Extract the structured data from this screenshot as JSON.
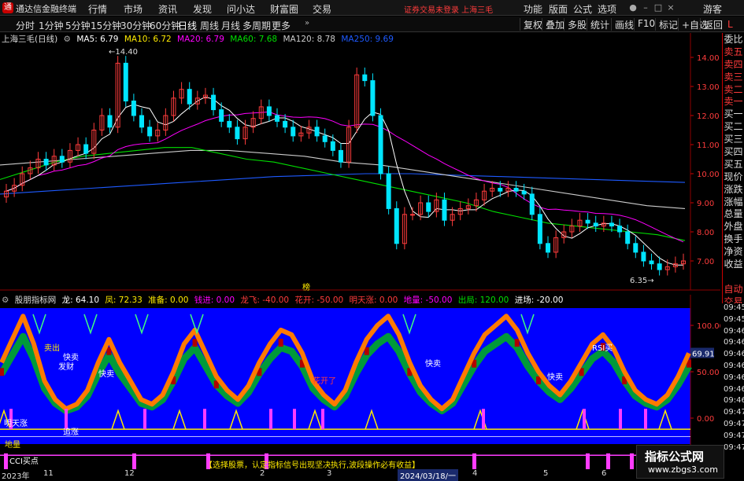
{
  "titlebar": {
    "app_name": "通达信金融终端",
    "menus": [
      "行情",
      "市场",
      "资讯",
      "发现",
      "问小达",
      "财富圈",
      "交易"
    ],
    "notice": "证券交易未登录  上海三毛",
    "right_menus": [
      "功能",
      "版面",
      "公式",
      "选项"
    ],
    "guest": "游客"
  },
  "tabbar": {
    "periods": [
      "分时",
      "1分钟",
      "5分钟",
      "15分钟",
      "30分钟",
      "60分钟",
      "日线",
      "周线",
      "月线",
      "多周期",
      "更多"
    ],
    "active": "日线",
    "tools": [
      "复权",
      "叠加",
      "多股",
      "统计",
      "画线",
      "F10",
      "标记",
      "+自选",
      "返回"
    ],
    "mark": "L"
  },
  "main_chart": {
    "stock_title": "上海三毛(日线)",
    "ma": [
      {
        "label": "MA5: 6.79",
        "color": "#ffffff"
      },
      {
        "label": "MA10: 6.72",
        "color": "#ffeb00"
      },
      {
        "label": "MA20: 6.79",
        "color": "#ff00ff"
      },
      {
        "label": "MA60: 7.68",
        "color": "#00e000"
      },
      {
        "label": "MA120: 8.78",
        "color": "#cccccc"
      },
      {
        "label": "MA250: 9.69",
        "color": "#1e5aff"
      }
    ],
    "y_ticks": [
      "14.00",
      "13.00",
      "12.00",
      "11.00",
      "10.00",
      "9.00",
      "8.00",
      "7.00"
    ],
    "high_label": "14.40",
    "low_label": "6.35",
    "marker": "榜",
    "candles_close": [
      9.4,
      9.6,
      10.0,
      10.2,
      10.5,
      10.3,
      10.6,
      10.4,
      10.8,
      11.0,
      10.7,
      11.5,
      12.0,
      11.6,
      13.8,
      12.5,
      12.0,
      11.6,
      11.3,
      11.5,
      12.0,
      12.6,
      12.9,
      12.4,
      12.6,
      12.7,
      12.2,
      11.8,
      11.6,
      11.2,
      11.6,
      11.9,
      12.3,
      12.0,
      11.8,
      11.6,
      11.3,
      11.4,
      11.6,
      11.3,
      11.1,
      10.8,
      10.4,
      11.6,
      13.4,
      13.2,
      12.0,
      10.0,
      8.8,
      7.6,
      8.6,
      8.6,
      9.0,
      8.7,
      9.1,
      8.4,
      8.6,
      8.8,
      8.9,
      9.1,
      9.4,
      9.5,
      9.4,
      9.5,
      9.4,
      9.3,
      8.6,
      7.6,
      7.3,
      7.8,
      8.0,
      8.2,
      8.4,
      8.3,
      8.2,
      8.3,
      8.2,
      8.0,
      7.6,
      7.3,
      7.0,
      6.9,
      6.7,
      6.8,
      6.9,
      7.0
    ],
    "ma60_values": [
      9.8,
      10.1,
      10.4,
      10.6,
      10.7,
      10.8,
      10.9,
      10.9,
      10.7,
      10.5,
      10.4,
      10.2,
      10.0,
      9.8,
      9.6,
      9.4,
      9.2,
      9.0,
      8.7,
      8.5,
      8.3,
      8.2,
      8.1,
      8.0,
      7.9,
      7.7
    ],
    "ma250_values": [
      9.3,
      9.4,
      9.5,
      9.6,
      9.7,
      9.8,
      9.9,
      9.95,
      10.0,
      10.0,
      9.95,
      9.9,
      9.85,
      9.8,
      9.75,
      9.7
    ],
    "ma120_values": [
      10.3,
      10.4,
      10.5,
      10.6,
      10.7,
      10.8,
      10.8,
      10.7,
      10.6,
      10.4,
      10.3,
      10.1,
      9.9,
      9.7,
      9.5,
      9.3,
      9.1,
      8.9,
      8.8
    ]
  },
  "indicator": {
    "name": "股朋指标网",
    "values": [
      {
        "label": "龙: 64.10",
        "color": "#ffffff"
      },
      {
        "label": "凤: 72.33",
        "color": "#ffeb00"
      },
      {
        "label": "准备: 0.00",
        "color": "#ffeb00"
      },
      {
        "label": "钱进: 0.00",
        "color": "#ff00ff"
      },
      {
        "label": "龙飞: -40.00",
        "color": "#ff3c3c"
      },
      {
        "label": "花开: -50.00",
        "color": "#ff3c3c"
      },
      {
        "label": "明天涨: 0.00",
        "color": "#ff3c3c"
      },
      {
        "label": "地量: -50.00",
        "color": "#ff00ff"
      },
      {
        "label": "出局: 120.00",
        "color": "#00e000"
      },
      {
        "label": "进场: -20.00",
        "color": "#ffffff"
      }
    ],
    "y_ticks": [
      "100.00",
      "50.00",
      "0.00"
    ],
    "current_value": "69.91",
    "annotations": [
      {
        "text": "卖出",
        "color": "#ffeb00"
      },
      {
        "text": "快卖",
        "color": "#ffffff"
      },
      {
        "text": "发财",
        "color": "#ffffff"
      },
      {
        "text": "快卖",
        "color": "#ffffff"
      },
      {
        "text": "快卖",
        "color": "#ffffff"
      },
      {
        "text": "快卖",
        "color": "#ffffff"
      },
      {
        "text": "RSI买",
        "color": "#ffffff"
      },
      {
        "text": "花开了",
        "color": "#ff3c3c"
      },
      {
        "text": "明天涨",
        "color": "#ffffff"
      },
      {
        "text": "追涨",
        "color": "#ffffff"
      },
      {
        "text": "CCI买点",
        "color": "#ffffff"
      },
      {
        "text": "地量",
        "color": "#ffeb00"
      }
    ],
    "hint": "【选择股票，认定指标信号出现坚决执行,波段操作必有收益】",
    "dragon_values": [
      60,
      85,
      110,
      80,
      40,
      20,
      10,
      15,
      30,
      60,
      85,
      60,
      40,
      20,
      15,
      25,
      50,
      80,
      95,
      70,
      45,
      30,
      20,
      35,
      60,
      80,
      95,
      90,
      70,
      40,
      25,
      15,
      30,
      60,
      85,
      100,
      110,
      90,
      60,
      35,
      20,
      10,
      20,
      45,
      70,
      90,
      100,
      110,
      95,
      70,
      50,
      35,
      25,
      40,
      60,
      80,
      90,
      75,
      50,
      30,
      20,
      15,
      25,
      45,
      70
    ]
  },
  "right_panel": {
    "items": [
      "委比",
      "卖五",
      "卖四",
      "卖三",
      "卖二",
      "卖一",
      "买一",
      "买二",
      "买三",
      "买四",
      "买五",
      "现价",
      "涨跌",
      "涨幅",
      "总量",
      "外盘",
      "换手",
      "净资",
      "收益",
      "",
      "自动",
      "交易"
    ],
    "times": [
      "09:45",
      "09:45",
      "09:46",
      "09:46",
      "09:46",
      "09:46",
      "09:46",
      "09:46",
      "09:46",
      "09:47",
      "09:47",
      "09:47",
      "09:47"
    ]
  },
  "datebar": {
    "labels": [
      "2023年",
      "11",
      "12",
      "2",
      "3",
      "4",
      "5",
      "6"
    ],
    "cursor_date": "2024/03/18/一"
  },
  "watermark": {
    "title": "指标公式网",
    "url": "www.zbgs3.com"
  }
}
